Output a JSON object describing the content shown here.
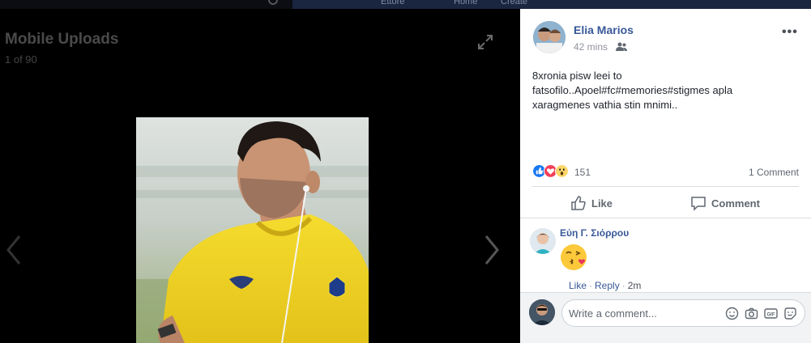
{
  "top_nav": {
    "items": [
      "Ettore",
      "Home",
      "Create"
    ]
  },
  "viewer": {
    "album_title": "Mobile Uploads",
    "position": "1 of 90",
    "photo_jersey_badge": "APOEL"
  },
  "post": {
    "author": "Elia Marios",
    "time": "42 mins",
    "audience_icon": "friends-icon",
    "more_label": "•••",
    "text": "8xronia pisw leei to fatsofilo..Apoel#fc#memories#stigmes apla xaragmenes vathia stin mnimi..",
    "reactions": [
      "like",
      "love",
      "wow"
    ],
    "reaction_count": "151",
    "comment_count": "1 Comment",
    "actions": {
      "like": "Like",
      "comment": "Comment"
    }
  },
  "comments": [
    {
      "author": "Εύη Γ. Σιόρρου",
      "emoji": "kissing-face-with-heart",
      "like_label": "Like",
      "reply_label": "Reply",
      "time": "2m"
    }
  ],
  "composer": {
    "placeholder": "Write a comment..."
  },
  "colors": {
    "link": "#385898",
    "like_blue": "#1877f2",
    "love_red": "#f33e58",
    "wow_yellow": "#fcd669",
    "jersey_yellow": "#f2d72a"
  }
}
